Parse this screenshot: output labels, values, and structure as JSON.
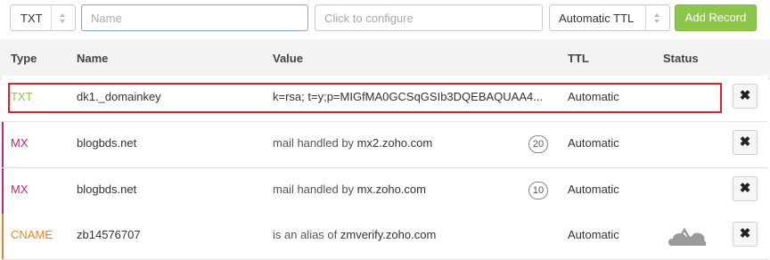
{
  "toolbar": {
    "type_value": "TXT",
    "name_placeholder": "Name",
    "value_placeholder": "Click to configure",
    "ttl_value": "Automatic TTL",
    "add_label": "Add Record"
  },
  "header": {
    "type": "Type",
    "name": "Name",
    "value": "Value",
    "ttl": "TTL",
    "status": "Status"
  },
  "records": [
    {
      "type": "TXT",
      "name": "dk1._domainkey",
      "value": "k=rsa; t=y;p=MIGfMA0GCSqGSIb3DQEBAQUAA4...",
      "ttl": "Automatic"
    },
    {
      "type": "MX",
      "name": "blogbds.net",
      "value_prefix": "mail handled by ",
      "value_host": "mx2.zoho.com",
      "priority": "20",
      "ttl": "Automatic"
    },
    {
      "type": "MX",
      "name": "blogbds.net",
      "value_prefix": "mail handled by ",
      "value_host": "mx.zoho.com",
      "priority": "10",
      "ttl": "Automatic"
    },
    {
      "type": "CNAME",
      "name": "zb14576707",
      "value_prefix": "is an alias of ",
      "value_host": "zmverify.zoho.com",
      "ttl": "Automatic",
      "status_icon": "cloud-icon"
    }
  ],
  "colors": {
    "txt": "#8ec54b",
    "mx": "#c8237d",
    "cname": "#e8841f",
    "add_button": "#8ec54b",
    "highlight": "#e0202a"
  },
  "icons": {
    "delete": "✖"
  }
}
